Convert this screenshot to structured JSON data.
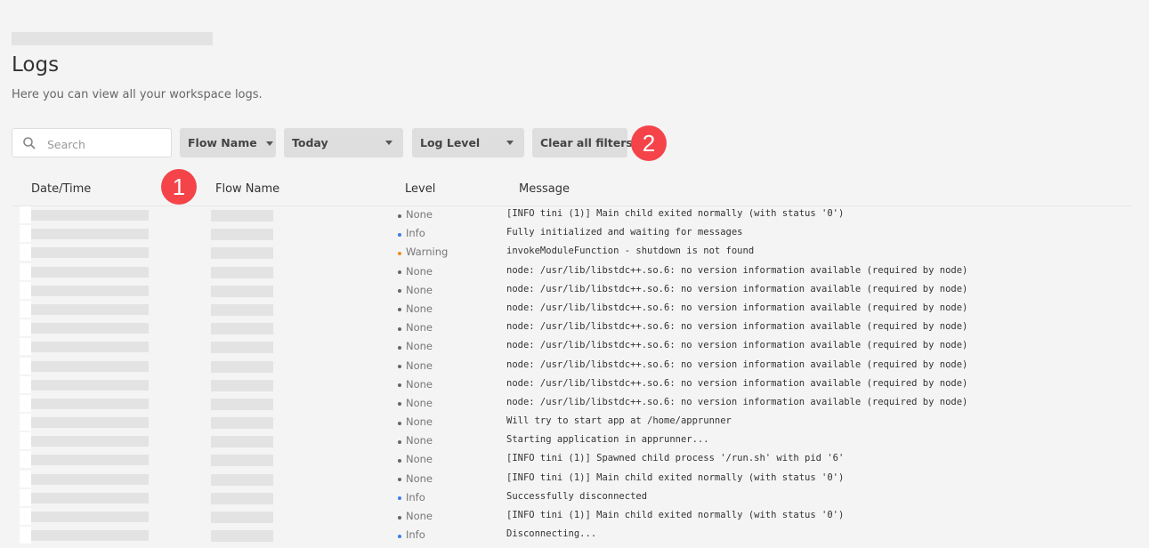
{
  "page": {
    "title": "Logs",
    "subtitle": "Here you can view all your workspace logs."
  },
  "filters": {
    "search_placeholder": "Search",
    "search_value": "",
    "flow_name_label": "Flow Name",
    "date_label": "Today",
    "log_level_label": "Log Level",
    "clear_label": "Clear all filters"
  },
  "annotations": {
    "badge_1": "1",
    "badge_2": "2"
  },
  "table": {
    "columns": [
      "Date/Time",
      "Flow Name",
      "Level",
      "Message"
    ],
    "level_colors": {
      "None": "#666666",
      "Info": "#3b7de9",
      "Warning": "#f08a24"
    },
    "rows": [
      {
        "level": "None",
        "message": "[INFO tini (1)] Main child exited normally (with status '0')"
      },
      {
        "level": "Info",
        "message": "Fully initialized and waiting for messages"
      },
      {
        "level": "Warning",
        "message": "invokeModuleFunction - shutdown is not found"
      },
      {
        "level": "None",
        "message": "node: /usr/lib/libstdc++.so.6: no version information available (required by node)"
      },
      {
        "level": "None",
        "message": "node: /usr/lib/libstdc++.so.6: no version information available (required by node)"
      },
      {
        "level": "None",
        "message": "node: /usr/lib/libstdc++.so.6: no version information available (required by node)"
      },
      {
        "level": "None",
        "message": "node: /usr/lib/libstdc++.so.6: no version information available (required by node)"
      },
      {
        "level": "None",
        "message": "node: /usr/lib/libstdc++.so.6: no version information available (required by node)"
      },
      {
        "level": "None",
        "message": "node: /usr/lib/libstdc++.so.6: no version information available (required by node)"
      },
      {
        "level": "None",
        "message": "node: /usr/lib/libstdc++.so.6: no version information available (required by node)"
      },
      {
        "level": "None",
        "message": "node: /usr/lib/libstdc++.so.6: no version information available (required by node)"
      },
      {
        "level": "None",
        "message": "Will try to start app at /home/apprunner"
      },
      {
        "level": "None",
        "message": "Starting application in apprunner..."
      },
      {
        "level": "None",
        "message": "[INFO tini (1)] Spawned child process '/run.sh' with pid '6'"
      },
      {
        "level": "None",
        "message": "[INFO tini (1)] Main child exited normally (with status '0')"
      },
      {
        "level": "Info",
        "message": "Successfully disconnected"
      },
      {
        "level": "None",
        "message": "[INFO tini (1)] Main child exited normally (with status '0')"
      },
      {
        "level": "Info",
        "message": "Disconnecting..."
      }
    ]
  }
}
